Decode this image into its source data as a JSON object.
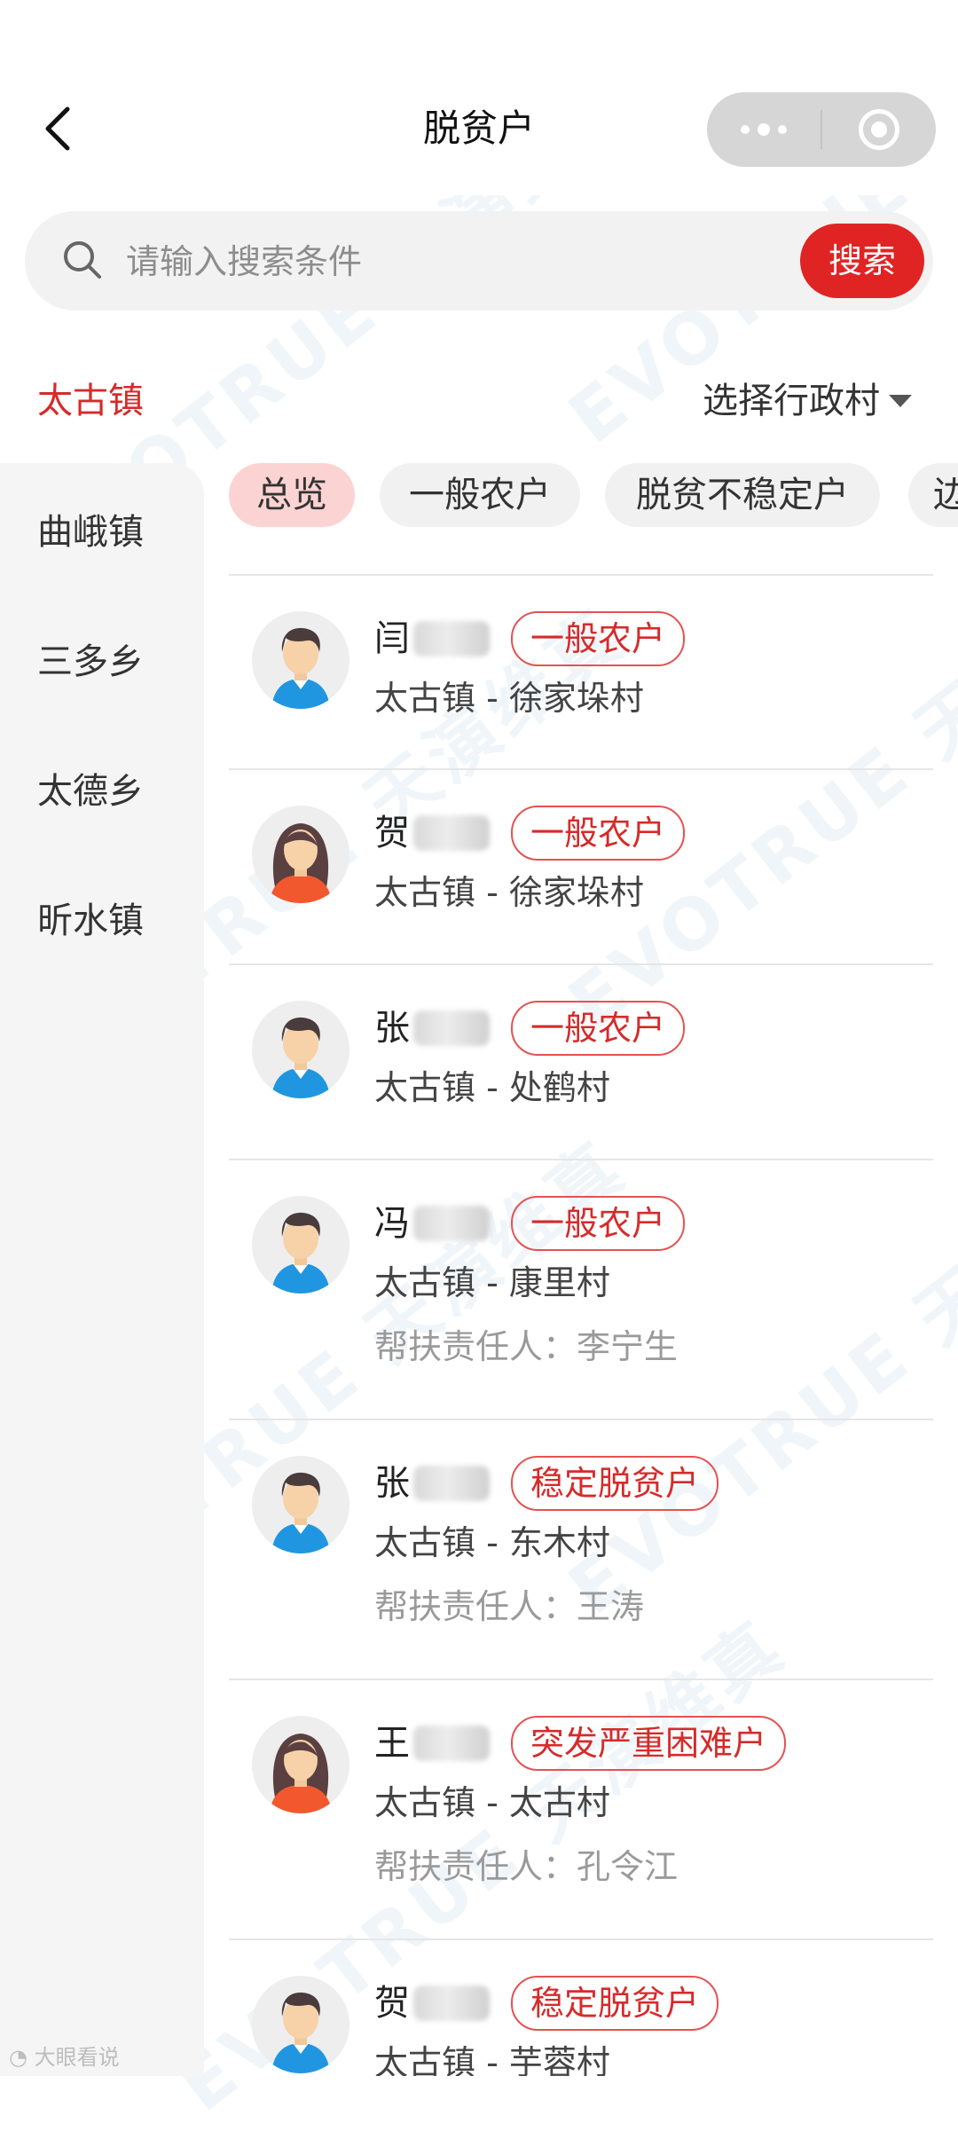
{
  "nav": {
    "title": "脱贫户",
    "back_icon": "chevron-left-icon",
    "more_icon": "more-dots-icon",
    "close_icon": "target-circle-icon"
  },
  "search": {
    "placeholder": "请输入搜索条件",
    "value": "",
    "button_label": "搜索",
    "icon": "search-icon",
    "button_color": "#e02424"
  },
  "filter": {
    "current_town": "太古镇",
    "village_select_label": "选择行政村",
    "caret_icon": "caret-down-icon"
  },
  "sidebar": {
    "items": [
      {
        "label": "曲峨镇"
      },
      {
        "label": "三多乡"
      },
      {
        "label": "太德乡"
      },
      {
        "label": "昕水镇"
      }
    ]
  },
  "tabs": [
    {
      "label": "总览",
      "active": true
    },
    {
      "label": "一般农户",
      "active": false
    },
    {
      "label": "脱贫不稳定户",
      "active": false
    },
    {
      "label": "边",
      "active": false
    }
  ],
  "households": [
    {
      "surname": "闫",
      "gender": "male",
      "tag": "一般农户",
      "location": "太古镇 - 徐家垛村",
      "helper": ""
    },
    {
      "surname": "贺",
      "gender": "female",
      "tag": "一般农户",
      "location": "太古镇 - 徐家垛村",
      "helper": ""
    },
    {
      "surname": "张",
      "gender": "male",
      "tag": "一般农户",
      "location": "太古镇 - 处鹤村",
      "helper": ""
    },
    {
      "surname": "冯",
      "gender": "male",
      "tag": "一般农户",
      "location": "太古镇 - 康里村",
      "helper": "帮扶责任人：李宁生"
    },
    {
      "surname": "张",
      "gender": "male",
      "tag": "稳定脱贫户",
      "location": "太古镇 - 东木村",
      "helper": "帮扶责任人：王涛"
    },
    {
      "surname": "王",
      "gender": "female",
      "tag": "突发严重困难户",
      "location": "太古镇 - 太古村",
      "helper": "帮扶责任人：孔令江"
    },
    {
      "surname": "贺",
      "gender": "male",
      "tag": "稳定脱贫户",
      "location": "太古镇 - 芋蓉村",
      "helper": ""
    }
  ],
  "colors": {
    "accent": "#d52b2b",
    "tab_active_bg": "#fbd3d3",
    "sidebar_bg": "#f5f5f5"
  }
}
